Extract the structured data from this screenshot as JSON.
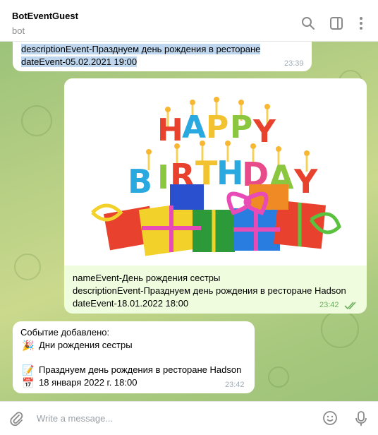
{
  "header": {
    "title": "BotEventGuest",
    "subtitle": "bot",
    "icons": [
      "search-icon",
      "sidebar-icon",
      "more-icon"
    ]
  },
  "messages": [
    {
      "type": "incoming",
      "lines": [
        "descriptionEvent-Празднуем день рождения в ресторане",
        "dateEvent-05.02.2021 19:00"
      ],
      "time": "23:39"
    },
    {
      "type": "outgoing",
      "image": {
        "banner_top": "HAPPY",
        "banner_bottom": "BIRTHDAY"
      },
      "lines": [
        "nameEvent-День рождения сестры",
        "descriptionEvent-Празднуем день рождения в ресторане Hadson",
        "dateEvent-18.01.2022 18:00"
      ],
      "time": "23:42",
      "status": "read"
    },
    {
      "type": "incoming",
      "lines": [
        "Событие добавлено:",
        "Дни рождения сестры",
        "",
        "Празднуем день рождения в ресторане Hadson",
        "18 января 2022 г. 18:00"
      ],
      "emoji": [
        "party-popper-icon",
        "memo-icon",
        "calendar-icon"
      ],
      "time": "23:42"
    }
  ],
  "composer": {
    "placeholder": "Write a message..."
  }
}
